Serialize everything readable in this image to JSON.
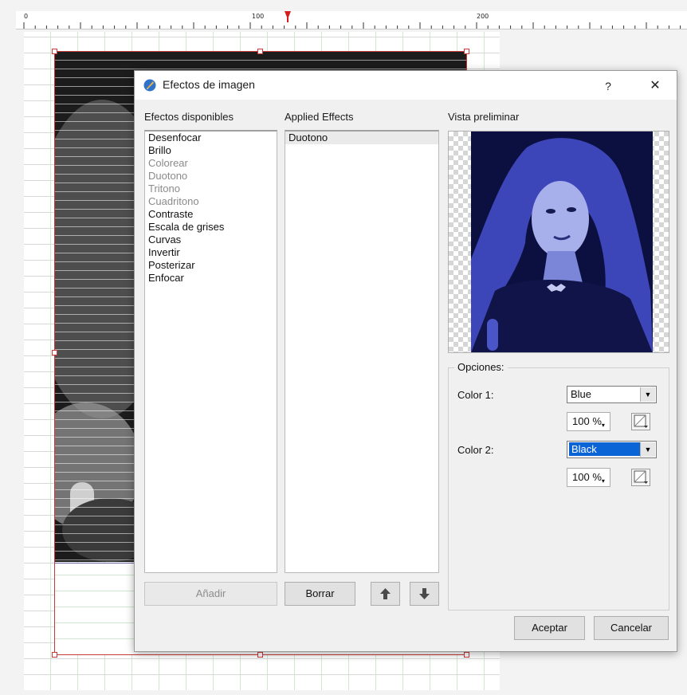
{
  "ruler": {
    "marks": [
      "0",
      "100",
      "200"
    ]
  },
  "dialog": {
    "title": "Efectos de imagen",
    "help_label": "?",
    "close_label": "✕",
    "available": {
      "label": "Efectos disponibles",
      "items": [
        {
          "text": "Desenfocar",
          "enabled": true
        },
        {
          "text": "Brillo",
          "enabled": true
        },
        {
          "text": "Colorear",
          "enabled": false
        },
        {
          "text": "Duotono",
          "enabled": false
        },
        {
          "text": "Tritono",
          "enabled": false
        },
        {
          "text": "Cuadritono",
          "enabled": false
        },
        {
          "text": "Contraste",
          "enabled": true
        },
        {
          "text": "Escala de grises",
          "enabled": true
        },
        {
          "text": "Curvas",
          "enabled": true
        },
        {
          "text": "Invertir",
          "enabled": true
        },
        {
          "text": "Posterizar",
          "enabled": true
        },
        {
          "text": "Enfocar",
          "enabled": true
        }
      ]
    },
    "applied": {
      "label": "Applied Effects",
      "items": [
        {
          "text": "Duotono"
        }
      ]
    },
    "preview": {
      "label": "Vista preliminar"
    },
    "options": {
      "legend": "Opciones:",
      "color1": {
        "label": "Color 1:",
        "value": "Blue",
        "percent": "100 %"
      },
      "color2": {
        "label": "Color 2:",
        "value": "Black",
        "percent": "100 %"
      }
    },
    "buttons": {
      "add": "Añadir",
      "delete": "Borrar",
      "up_icon": "arrow-up-icon",
      "down_icon": "arrow-down-icon",
      "ok": "Aceptar",
      "cancel": "Cancelar"
    }
  }
}
